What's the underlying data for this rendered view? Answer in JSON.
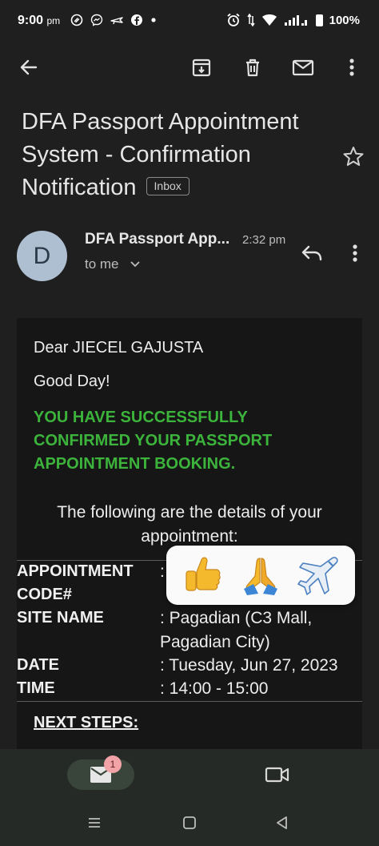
{
  "status_bar": {
    "time": "9:00",
    "ampm": "pm",
    "battery": "100%"
  },
  "email": {
    "subject": "DFA Passport Appointment System - Confirmation Notification",
    "label": "Inbox",
    "sender_name": "DFA Passport App...",
    "sender_initial": "D",
    "time": "2:32 pm",
    "recipient": "to me",
    "avatar_color": "#aebfd1"
  },
  "body": {
    "greeting": "Dear JIECEL GAJUSTA",
    "good_day": "Good Day!",
    "success_message": "YOU HAVE SUCCESSFULLY CONFIRMED YOUR PASSPORT APPOINTMENT BOOKING.",
    "success_color": "#3cb43c",
    "details_intro": "The following are the details of your appointment:",
    "rows": [
      {
        "label": "APPOINTMENT CODE#",
        "value": ":"
      },
      {
        "label": "SITE NAME",
        "value": ": Pagadian (C3 Mall, Pagadian City)"
      },
      {
        "label": "DATE",
        "value": ": Tuesday, Jun 27, 2023"
      },
      {
        "label": "TIME",
        "value": ": 14:00 - 15:00"
      }
    ],
    "next_steps": "NEXT STEPS:"
  },
  "reactions": [
    "thumbs-up",
    "folded-hands",
    "airplane"
  ],
  "bottom_nav": {
    "mail_badge": "1"
  }
}
